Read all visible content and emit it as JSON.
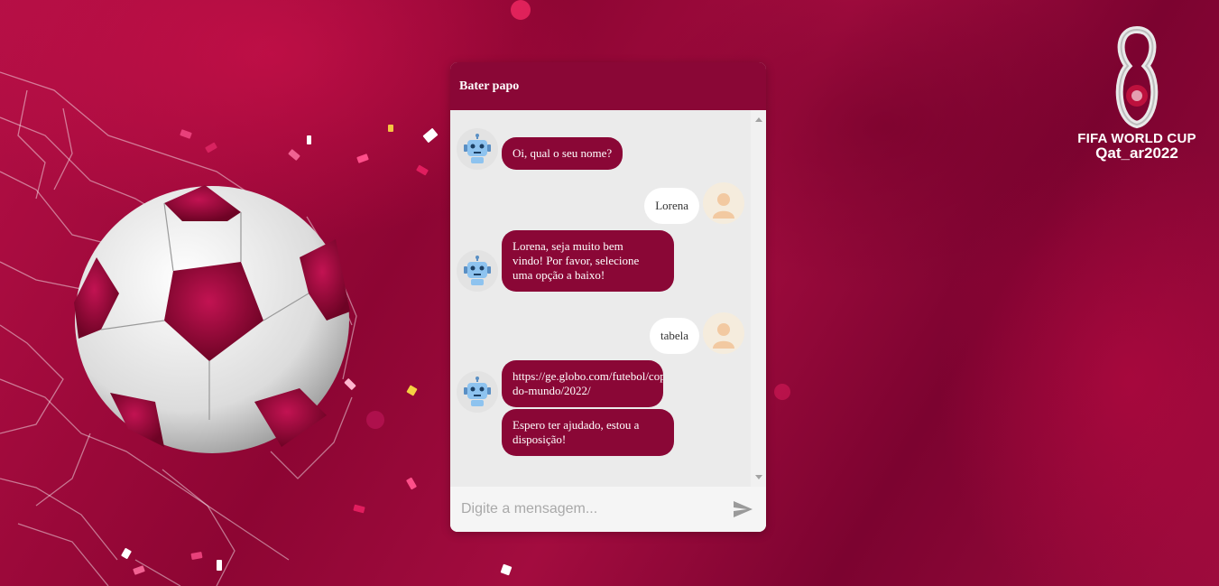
{
  "colors": {
    "brand": "#8a0736",
    "background": "#9c0b3c",
    "chat_bg": "#ebebeb",
    "user_bubble": "#ffffff"
  },
  "logo": {
    "line1": "FIFA WORLD CUP",
    "line2": "Qat_ar2022"
  },
  "chat": {
    "title": "Bater papo",
    "messages": [
      {
        "from": "bot",
        "text": "Oi, qual o seu nome?"
      },
      {
        "from": "user",
        "text": "Lorena"
      },
      {
        "from": "bot",
        "lines": [
          "Lorena, seja muito bem",
          "vindo! Por favor, selecione",
          "uma opção a baixo!"
        ]
      },
      {
        "from": "user",
        "text": "tabela"
      },
      {
        "from": "bot",
        "lines": [
          "https://ge.globo.com/futebol/copa-",
          "do-mundo/2022/"
        ]
      },
      {
        "from": "bot",
        "lines": [
          "Espero ter ajudado, estou a",
          "disposição!"
        ]
      }
    ],
    "input": {
      "placeholder": "Digite a mensagem...",
      "value": ""
    },
    "icons": {
      "bot": "robot-icon",
      "user": "user-avatar-icon",
      "send": "send-icon"
    }
  }
}
